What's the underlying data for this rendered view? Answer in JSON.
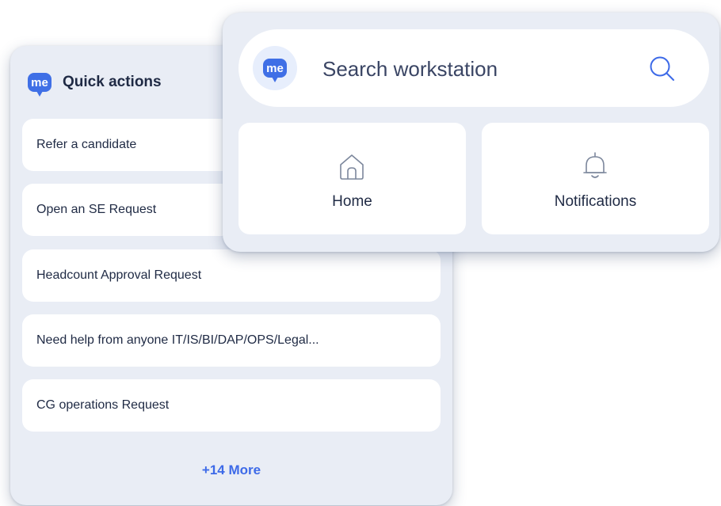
{
  "quick_actions": {
    "title": "Quick actions",
    "logo_text": "me",
    "items": [
      {
        "label": "Refer a candidate"
      },
      {
        "label": "Open an SE Request"
      },
      {
        "label": "Headcount Approval Request"
      },
      {
        "label": "Need help from anyone IT/IS/BI/DAP/OPS/Legal..."
      },
      {
        "label": "CG operations Request"
      }
    ],
    "more_label": "+14 More"
  },
  "search": {
    "logo_text": "me",
    "placeholder": "Search workstation",
    "icon": "search-icon"
  },
  "nav": {
    "tiles": [
      {
        "label": "Home",
        "icon": "home-icon"
      },
      {
        "label": "Notifications",
        "icon": "bell-icon"
      }
    ]
  },
  "colors": {
    "accent": "#3d6ae8",
    "panel_bg": "#e9edf5",
    "card_bg": "#ffffff",
    "text": "#1f2a44"
  }
}
